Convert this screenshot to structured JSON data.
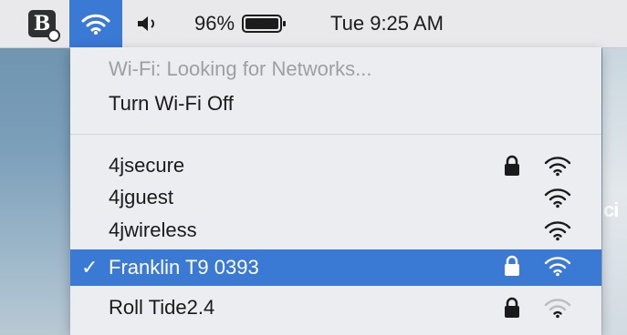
{
  "menubar": {
    "app_icon": "bitdefender-shield-icon",
    "wifi_icon": "wifi-icon",
    "volume_icon": "speaker-icon",
    "battery_percent": "96%",
    "battery_icon": "battery-icon",
    "clock": "Tue 9:25 AM",
    "accent_color": "#3a79d4"
  },
  "wifi_menu": {
    "status": "Wi-Fi: Looking for Networks...",
    "toggle_label": "Turn Wi-Fi Off",
    "networks": [
      {
        "name": "4jsecure",
        "locked": true,
        "selected": false,
        "signal": "strong"
      },
      {
        "name": "4jguest",
        "locked": false,
        "selected": false,
        "signal": "strong"
      },
      {
        "name": "4jwireless",
        "locked": false,
        "selected": false,
        "signal": "strong"
      },
      {
        "name": "Franklin T9 0393",
        "locked": true,
        "selected": true,
        "signal": "strong"
      },
      {
        "name": "Roll Tide2.4",
        "locked": true,
        "selected": false,
        "signal": "weak"
      }
    ],
    "selected_check": "✓"
  },
  "desktop": {
    "partial_text": "ci"
  }
}
